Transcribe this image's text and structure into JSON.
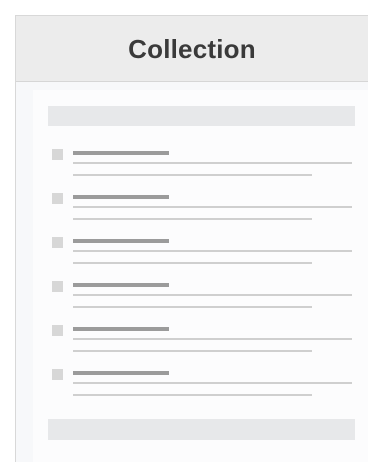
{
  "window": {
    "title": "Collection"
  },
  "list": {
    "items": [
      {
        "id": 1
      },
      {
        "id": 2
      },
      {
        "id": 3
      },
      {
        "id": 4
      },
      {
        "id": 5
      },
      {
        "id": 6
      }
    ]
  }
}
